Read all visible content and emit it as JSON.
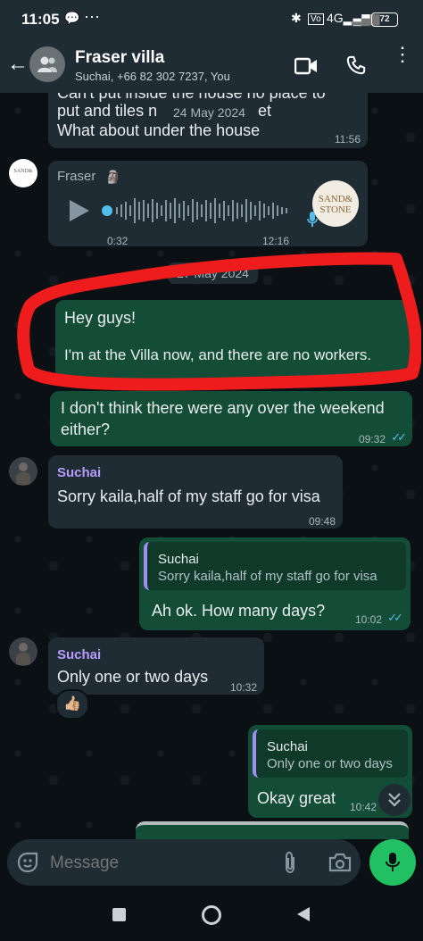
{
  "status_bar": {
    "time": "11:05",
    "battery": "72"
  },
  "header": {
    "title": "Fraser villa",
    "subtitle": "Suchai, +66 82 302 7237, You"
  },
  "chat": {
    "date_chip": "24 May 2024",
    "msg1": {
      "line1": "Can't put inside the house no place to",
      "line2": "put and tiles n",
      "line2b": "et",
      "line3": "What about under the house",
      "time": "11:56"
    },
    "voice": {
      "sender": "Fraser",
      "position": "0:32",
      "time": "12:16",
      "logo_line1": "SAND&",
      "logo_line2": "STONE",
      "progress": 0.0
    },
    "date_chip2": "27 May 2024",
    "msg2": {
      "line1": "Hey guys!",
      "line2": "I'm at the Villa now, and there are no workers."
    },
    "msg3": {
      "line1": "I don't think there were any over the weekend",
      "line2": "either?",
      "time": "09:32"
    },
    "msg4": {
      "sender": "Suchai",
      "text": "Sorry kaila,half of my staff go for visa",
      "time": "09:48"
    },
    "msg5": {
      "quote_sender": "Suchai",
      "quote_text": "Sorry kaila,half of my staff go for visa",
      "text": "Ah ok. How many days?",
      "time": "10:02"
    },
    "msg6": {
      "sender": "Suchai",
      "text": "Only one or two days",
      "time": "10:32",
      "reaction": "👍🏼"
    },
    "msg7": {
      "quote_sender": "Suchai",
      "quote_text": "Only one or two days",
      "text": "Okay great",
      "time": "10:42"
    }
  },
  "input": {
    "placeholder": "Message"
  },
  "colors": {
    "accent_green": "#21c063",
    "outgoing_bubble": "#144d37",
    "incoming_bubble": "#1f2c34",
    "annotation_red": "#ee1c1c"
  }
}
